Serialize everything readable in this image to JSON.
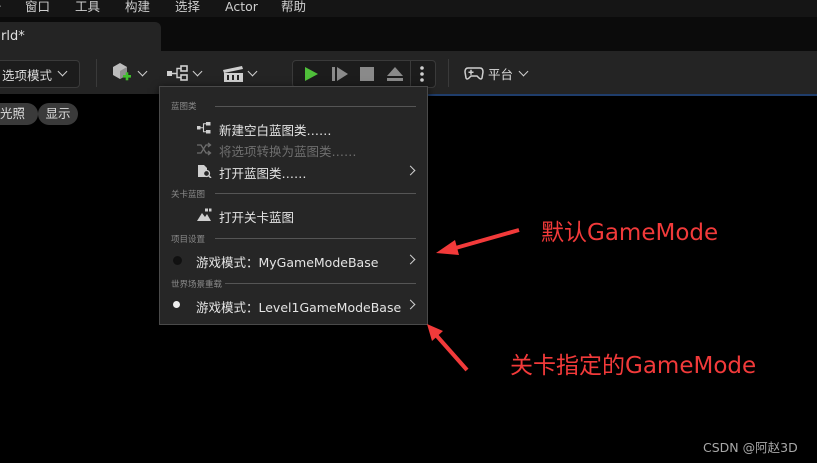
{
  "menubar": {
    "items": [
      "窗口",
      "工具",
      "构建",
      "选择",
      "Actor",
      "帮助"
    ]
  },
  "tab": {
    "title": "rld*"
  },
  "toolbar": {
    "mode_label": "选项模式",
    "platform_label": "平台",
    "icons": [
      "add-actor-icon",
      "blueprint-icon",
      "cinematics-icon",
      "play-icon",
      "advance-frame-icon",
      "stop-icon",
      "eject-icon",
      "more-icon",
      "gamepad-icon"
    ]
  },
  "viewport": {
    "chip_lighting": "光照",
    "chip_show": "显示"
  },
  "blueprint_menu": {
    "section_blueprint": "蓝图类",
    "new_empty_blueprint": "新建空白蓝图类……",
    "convert_to_blueprint": "将选项转换为蓝图类……",
    "open_blueprint": "打开蓝图类……",
    "section_level_blueprint": "关卡蓝图",
    "open_level_blueprint": "打开关卡蓝图",
    "section_project_settings": "项目设置",
    "project_game_mode": "游戏模式：MyGameModeBase",
    "section_world_override": "世界场景重载",
    "world_game_mode": "游戏模式：Level1GameModeBase"
  },
  "annotations": {
    "default_label": "默认GameMode",
    "level_label": "关卡指定的GameMode",
    "color": "#f23a3a"
  },
  "watermark": "CSDN @阿赵3D",
  "colors": {
    "play_green": "#4fbf3a",
    "add_badge_green": "#3fbf2c",
    "toolbar_bg": "#242424",
    "menu_bg": "#262626",
    "viewport_accent_line": "#1f3d6b"
  }
}
